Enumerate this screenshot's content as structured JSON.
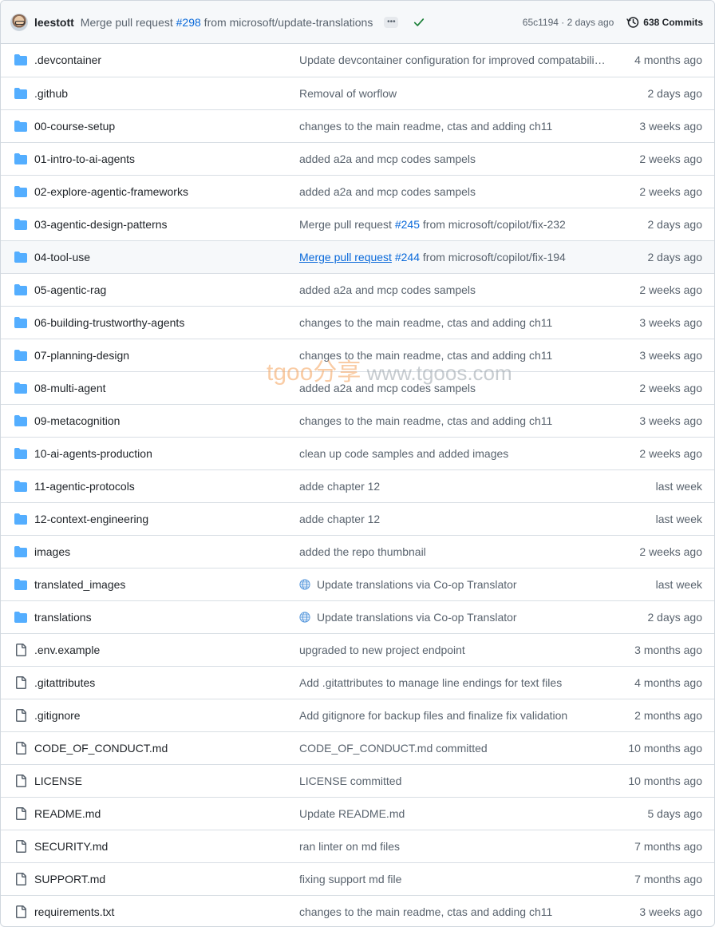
{
  "header": {
    "author": "leestott",
    "commit_prefix": "Merge pull request ",
    "commit_pr": "#298",
    "commit_suffix": " from microsoft/update-translations",
    "ellipsis": "•••",
    "sha_date": "65c1194 · 2 days ago",
    "commits_label": "638 Commits"
  },
  "watermark": {
    "part1": "tgoo分享",
    "part2": " www.tgoos.com"
  },
  "files": [
    {
      "type": "folder",
      "name": ".devcontainer",
      "msg": "Update devcontainer configuration for improved compatabili…",
      "date": "4 months ago"
    },
    {
      "type": "folder",
      "name": ".github",
      "msg": "Removal of worflow",
      "date": "2 days ago"
    },
    {
      "type": "folder",
      "name": "00-course-setup",
      "msg": "changes to the main readme, ctas and adding ch11",
      "date": "3 weeks ago"
    },
    {
      "type": "folder",
      "name": "01-intro-to-ai-agents",
      "msg": "added a2a and mcp codes sampels",
      "date": "2 weeks ago"
    },
    {
      "type": "folder",
      "name": "02-explore-agentic-frameworks",
      "msg": "added a2a and mcp codes sampels",
      "date": "2 weeks ago"
    },
    {
      "type": "folder",
      "name": "03-agentic-design-patterns",
      "msg_pre": "Merge pull request ",
      "msg_pr": "#245",
      "msg_post": " from microsoft/copilot/fix-232",
      "date": "2 days ago"
    },
    {
      "type": "folder",
      "name": "04-tool-use",
      "msg_pre": "Merge pull request",
      "msg_pr": "#244",
      "msg_post": " from microsoft/copilot/fix-194",
      "date": "2 days ago",
      "hover": true
    },
    {
      "type": "folder",
      "name": "05-agentic-rag",
      "msg": "added a2a and mcp codes sampels",
      "date": "2 weeks ago"
    },
    {
      "type": "folder",
      "name": "06-building-trustworthy-agents",
      "msg": "changes to the main readme, ctas and adding ch11",
      "date": "3 weeks ago"
    },
    {
      "type": "folder",
      "name": "07-planning-design",
      "msg": "changes to the main readme, ctas and adding ch11",
      "date": "3 weeks ago"
    },
    {
      "type": "folder",
      "name": "08-multi-agent",
      "msg": "added a2a and mcp codes sampels",
      "date": "2 weeks ago"
    },
    {
      "type": "folder",
      "name": "09-metacognition",
      "msg": "changes to the main readme, ctas and adding ch11",
      "date": "3 weeks ago"
    },
    {
      "type": "folder",
      "name": "10-ai-agents-production",
      "msg": "clean up code samples and added images",
      "date": "2 weeks ago"
    },
    {
      "type": "folder",
      "name": "11-agentic-protocols",
      "msg": "adde chapter 12",
      "date": "last week"
    },
    {
      "type": "folder",
      "name": "12-context-engineering",
      "msg": "adde chapter 12",
      "date": "last week"
    },
    {
      "type": "folder",
      "name": "images",
      "msg": "added the repo thumbnail",
      "date": "2 weeks ago"
    },
    {
      "type": "folder",
      "name": "translated_images",
      "msg": "Update translations via Co-op Translator",
      "globe": true,
      "date": "last week"
    },
    {
      "type": "folder",
      "name": "translations",
      "msg": "Update translations via Co-op Translator",
      "globe": true,
      "date": "2 days ago"
    },
    {
      "type": "file",
      "name": ".env.example",
      "msg": "upgraded to new project endpoint",
      "date": "3 months ago"
    },
    {
      "type": "file",
      "name": ".gitattributes",
      "msg": "Add .gitattributes to manage line endings for text files",
      "date": "4 months ago"
    },
    {
      "type": "file",
      "name": ".gitignore",
      "msg": "Add gitignore for backup files and finalize fix validation",
      "date": "2 months ago"
    },
    {
      "type": "file",
      "name": "CODE_OF_CONDUCT.md",
      "msg": "CODE_OF_CONDUCT.md committed",
      "date": "10 months ago"
    },
    {
      "type": "file",
      "name": "LICENSE",
      "msg": "LICENSE committed",
      "date": "10 months ago"
    },
    {
      "type": "file",
      "name": "README.md",
      "msg": "Update README.md",
      "date": "5 days ago"
    },
    {
      "type": "file",
      "name": "SECURITY.md",
      "msg": "ran linter on md files",
      "date": "7 months ago"
    },
    {
      "type": "file",
      "name": "SUPPORT.md",
      "msg": "fixing support md file",
      "date": "7 months ago"
    },
    {
      "type": "file",
      "name": "requirements.txt",
      "msg": "changes to the main readme, ctas and adding ch11",
      "date": "3 weeks ago"
    }
  ],
  "colors": {
    "folder": "#54aeff",
    "file": "#59636e",
    "link": "#0969da",
    "check": "#1a7f37"
  }
}
